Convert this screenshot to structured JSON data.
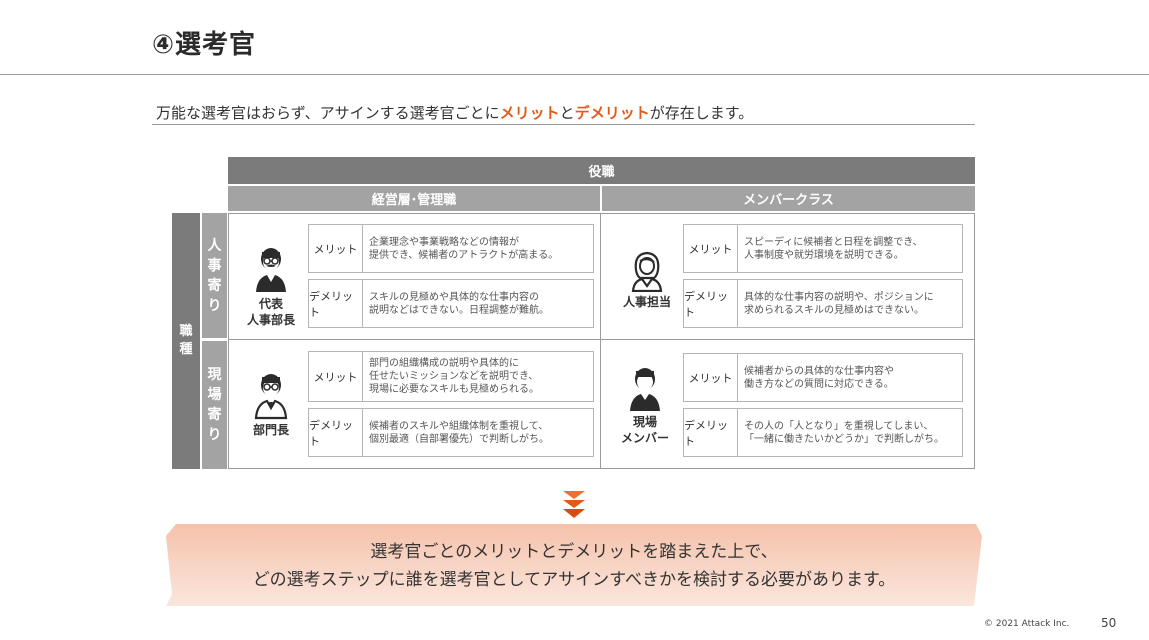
{
  "title": "④選考官",
  "lead": {
    "part1": "万能な選考官はおらず、アサインする選考官ごとに",
    "merit": "メリット",
    "and": "と",
    "demerit": "デメリット",
    "part2": "が存在します。"
  },
  "matrix": {
    "col_header": "役職",
    "row_header": "職種",
    "columns": [
      "経営層･管理職",
      "メンバークラス"
    ],
    "rows": [
      "人事寄り",
      "現場寄り"
    ],
    "merit_label": "メリット",
    "demerit_label": "デメリット",
    "cells": [
      {
        "person": [
          "代表",
          "人事部長"
        ],
        "merit": [
          "企業理念や事業戦略などの情報が",
          "提供でき、候補者のアトラクトが高まる。"
        ],
        "demerit": [
          "スキルの見極めや具体的な仕事内容の",
          "説明などはできない。日程調整が難航。"
        ]
      },
      {
        "person": [
          "人事担当"
        ],
        "merit": [
          "スピーディに候補者と日程を調整でき、",
          "人事制度や就労環境を説明できる。"
        ],
        "demerit": [
          "具体的な仕事内容の説明や、ポジションに",
          "求められるスキルの見極めはできない。"
        ]
      },
      {
        "person": [
          "部門長"
        ],
        "merit": [
          "部門の組織構成の説明や具体的に",
          "任せたいミッションなどを説明でき、",
          "現場に必要なスキルも見極められる。"
        ],
        "demerit": [
          "候補者のスキルや組織体制を重視して、",
          "個別最適（自部署優先）で判断しがち。"
        ]
      },
      {
        "person": [
          "現場",
          "メンバー"
        ],
        "merit": [
          "候補者からの具体的な仕事内容や",
          "働き方などの質問に対応できる。"
        ],
        "demerit": [
          "その人の「人となり」を重視してしまい、",
          "「一緒に働きたいかどうか」で判断しがち。"
        ]
      }
    ]
  },
  "conclusion": [
    "選考官ごとのメリットとデメリットを踏まえた上で、",
    "どの選考ステップに誰を選考官としてアサインすべきかを検討する必要があります。"
  ],
  "footer": {
    "copyright": "© 2021 Attack Inc.",
    "page": "50"
  },
  "colors": {
    "accent": "#e25a16",
    "banner": "#f6cdbb",
    "header_dark": "#7b7b7b",
    "header_light": "#a3a3a3"
  }
}
